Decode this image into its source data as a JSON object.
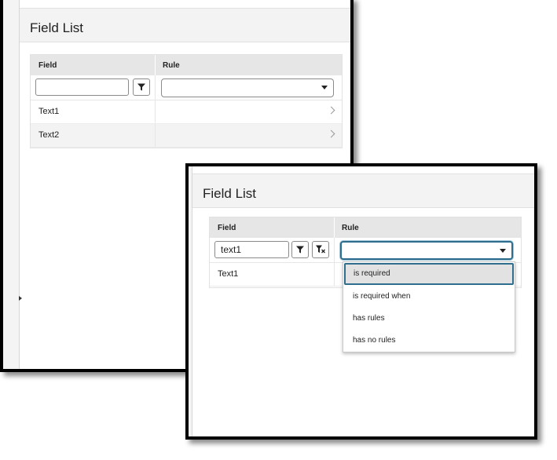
{
  "panel_back": {
    "title": "Field List",
    "columns": {
      "field": "Field",
      "rule": "Rule"
    },
    "field_filter_value": "",
    "rule_filter_value": "",
    "rows": [
      {
        "field": "Text1",
        "rule": ""
      },
      {
        "field": "Text2",
        "rule": ""
      }
    ]
  },
  "panel_front": {
    "title": "Field List",
    "columns": {
      "field": "Field",
      "rule": "Rule"
    },
    "field_filter_value": "text1",
    "rule_filter_value": "",
    "rows": [
      {
        "field": "Text1",
        "rule": ""
      }
    ],
    "rule_dropdown": {
      "open": true,
      "highlighted": "is required",
      "options": [
        "is required",
        "is required when",
        "has rules",
        "has no rules"
      ]
    }
  },
  "icons": {
    "filter": "filter-funnel-icon",
    "clear_filter": "clear-filter-icon",
    "row_chevron": "chevron-right-icon",
    "select_caret": "caret-down-icon"
  },
  "colors": {
    "focus_ring": "#2f6d8e",
    "grid_header_bg": "#e6e6e6",
    "panel_header_bg": "#f3f3f3"
  }
}
